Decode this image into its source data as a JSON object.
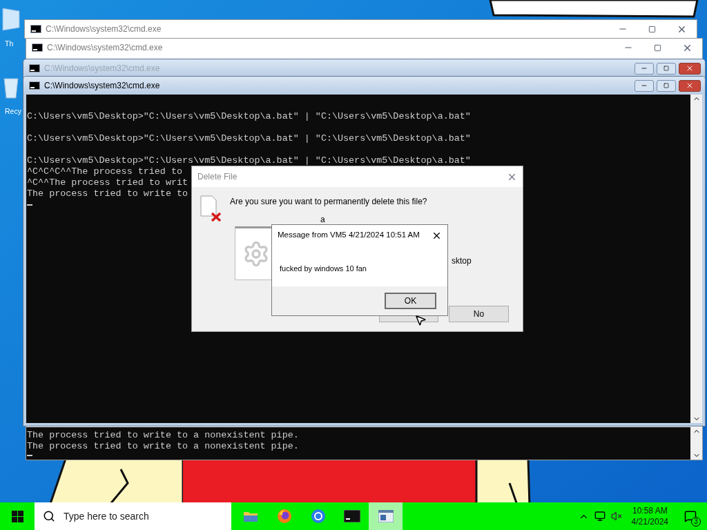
{
  "desktop": {
    "icons": [
      {
        "label": "Th",
        "kind": "pc"
      },
      {
        "label": "Recy",
        "kind": "bin"
      }
    ]
  },
  "windows": [
    {
      "title": "C:\\Windows\\system32\\cmd.exe",
      "kind": "modern",
      "active": false
    },
    {
      "title": "C:\\Windows\\system32\\cmd.exe",
      "kind": "modern",
      "active": false,
      "blocks": [
        {
          "lines": [
            "The process tried to write to a nonexistent pipe.",
            "The process tried to write to a nonexistent pipe."
          ]
        }
      ]
    },
    {
      "title": "C:\\Windows\\system32\\cmd.exe",
      "kind": "classic",
      "active": false
    },
    {
      "title": "C:\\Windows\\system32\\cmd.exe",
      "kind": "classic",
      "active": true,
      "blocks": [
        {
          "lines": [
            "C:\\Users\\vm5\\Desktop>\"C:\\Users\\vm5\\Desktop\\a.bat\" | \"C:\\Users\\vm5\\Desktop\\a.bat\""
          ]
        },
        {
          "lines": [
            "C:\\Users\\vm5\\Desktop>\"C:\\Users\\vm5\\Desktop\\a.bat\" | \"C:\\Users\\vm5\\Desktop\\a.bat\""
          ]
        },
        {
          "lines": [
            "C:\\Users\\vm5\\Desktop>\"C:\\Users\\vm5\\Desktop\\a.bat\" | \"C:\\Users\\vm5\\Desktop\\a.bat\"",
            "^C^C^C^^The process tried to",
            "^C^^The process tried to writ",
            "The process tried to write to"
          ]
        }
      ]
    }
  ],
  "delete_dialog": {
    "title": "Delete File",
    "question": "Are you sure you want to permanently delete this file?",
    "file_name": "a",
    "location_fragment": "sktop",
    "no_button": "No"
  },
  "message_box": {
    "title": "Message from VM5 4/21/2024 10:51 AM",
    "text": "fucked by windows 10 fan",
    "ok_button": "OK"
  },
  "taskbar": {
    "search_placeholder": "Type here to search",
    "apps": [
      {
        "kind": "folder",
        "selected": false
      },
      {
        "kind": "firefox",
        "selected": false
      },
      {
        "kind": "chrome",
        "selected": false
      },
      {
        "kind": "console",
        "selected": false
      },
      {
        "kind": "window",
        "selected": true
      }
    ],
    "time": "10:58 AM",
    "date": "4/21/2024",
    "notification_count": "3"
  }
}
